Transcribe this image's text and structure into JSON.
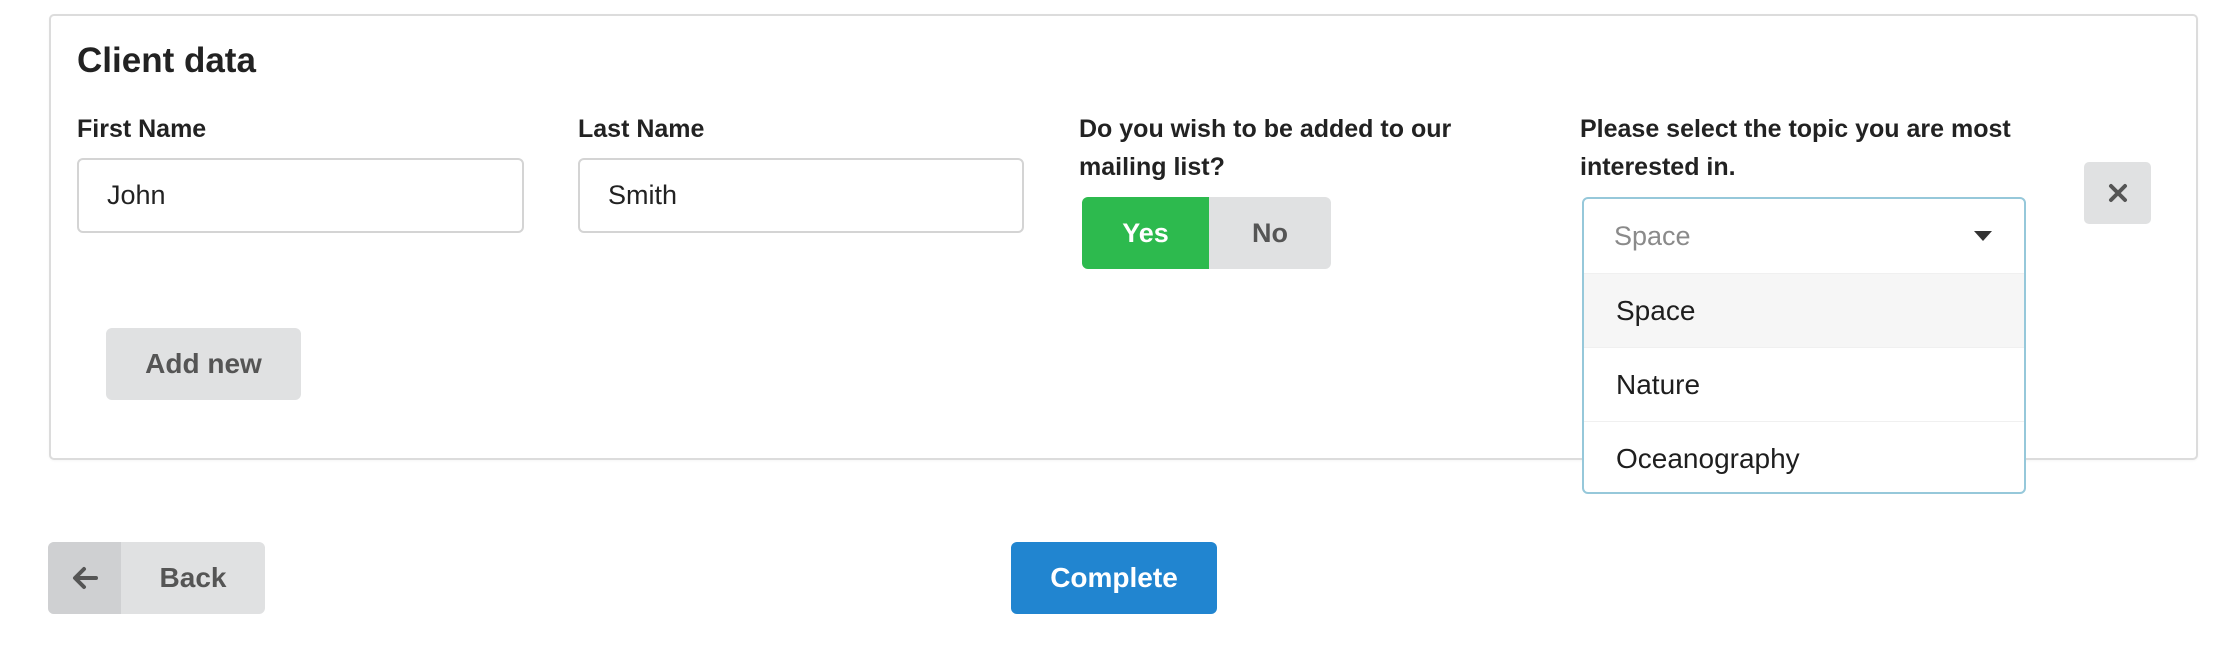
{
  "panel": {
    "title": "Client data",
    "first_name": {
      "label": "First Name",
      "value": "John"
    },
    "last_name": {
      "label": "Last Name",
      "value": "Smith"
    },
    "mailing": {
      "label_line1": "Do you wish to be added to our",
      "label_line2": "mailing list?",
      "yes": "Yes",
      "no": "No",
      "selected": "Yes"
    },
    "topic": {
      "label_line1": "Please select the topic you are most",
      "label_line2": "interested in.",
      "selected_text": "Space",
      "options": [
        "Space",
        "Nature",
        "Oceanography"
      ],
      "highlighted_option": "Space"
    },
    "add_new": "Add new",
    "remove_icon": "close-icon"
  },
  "footer": {
    "back": "Back",
    "back_icon": "arrow-left-icon",
    "complete": "Complete"
  },
  "colors": {
    "yes_active": "#2dba4e",
    "primary": "#2185d0",
    "neutral_button": "#e0e1e2",
    "dropdown_border": "#96c8da"
  }
}
